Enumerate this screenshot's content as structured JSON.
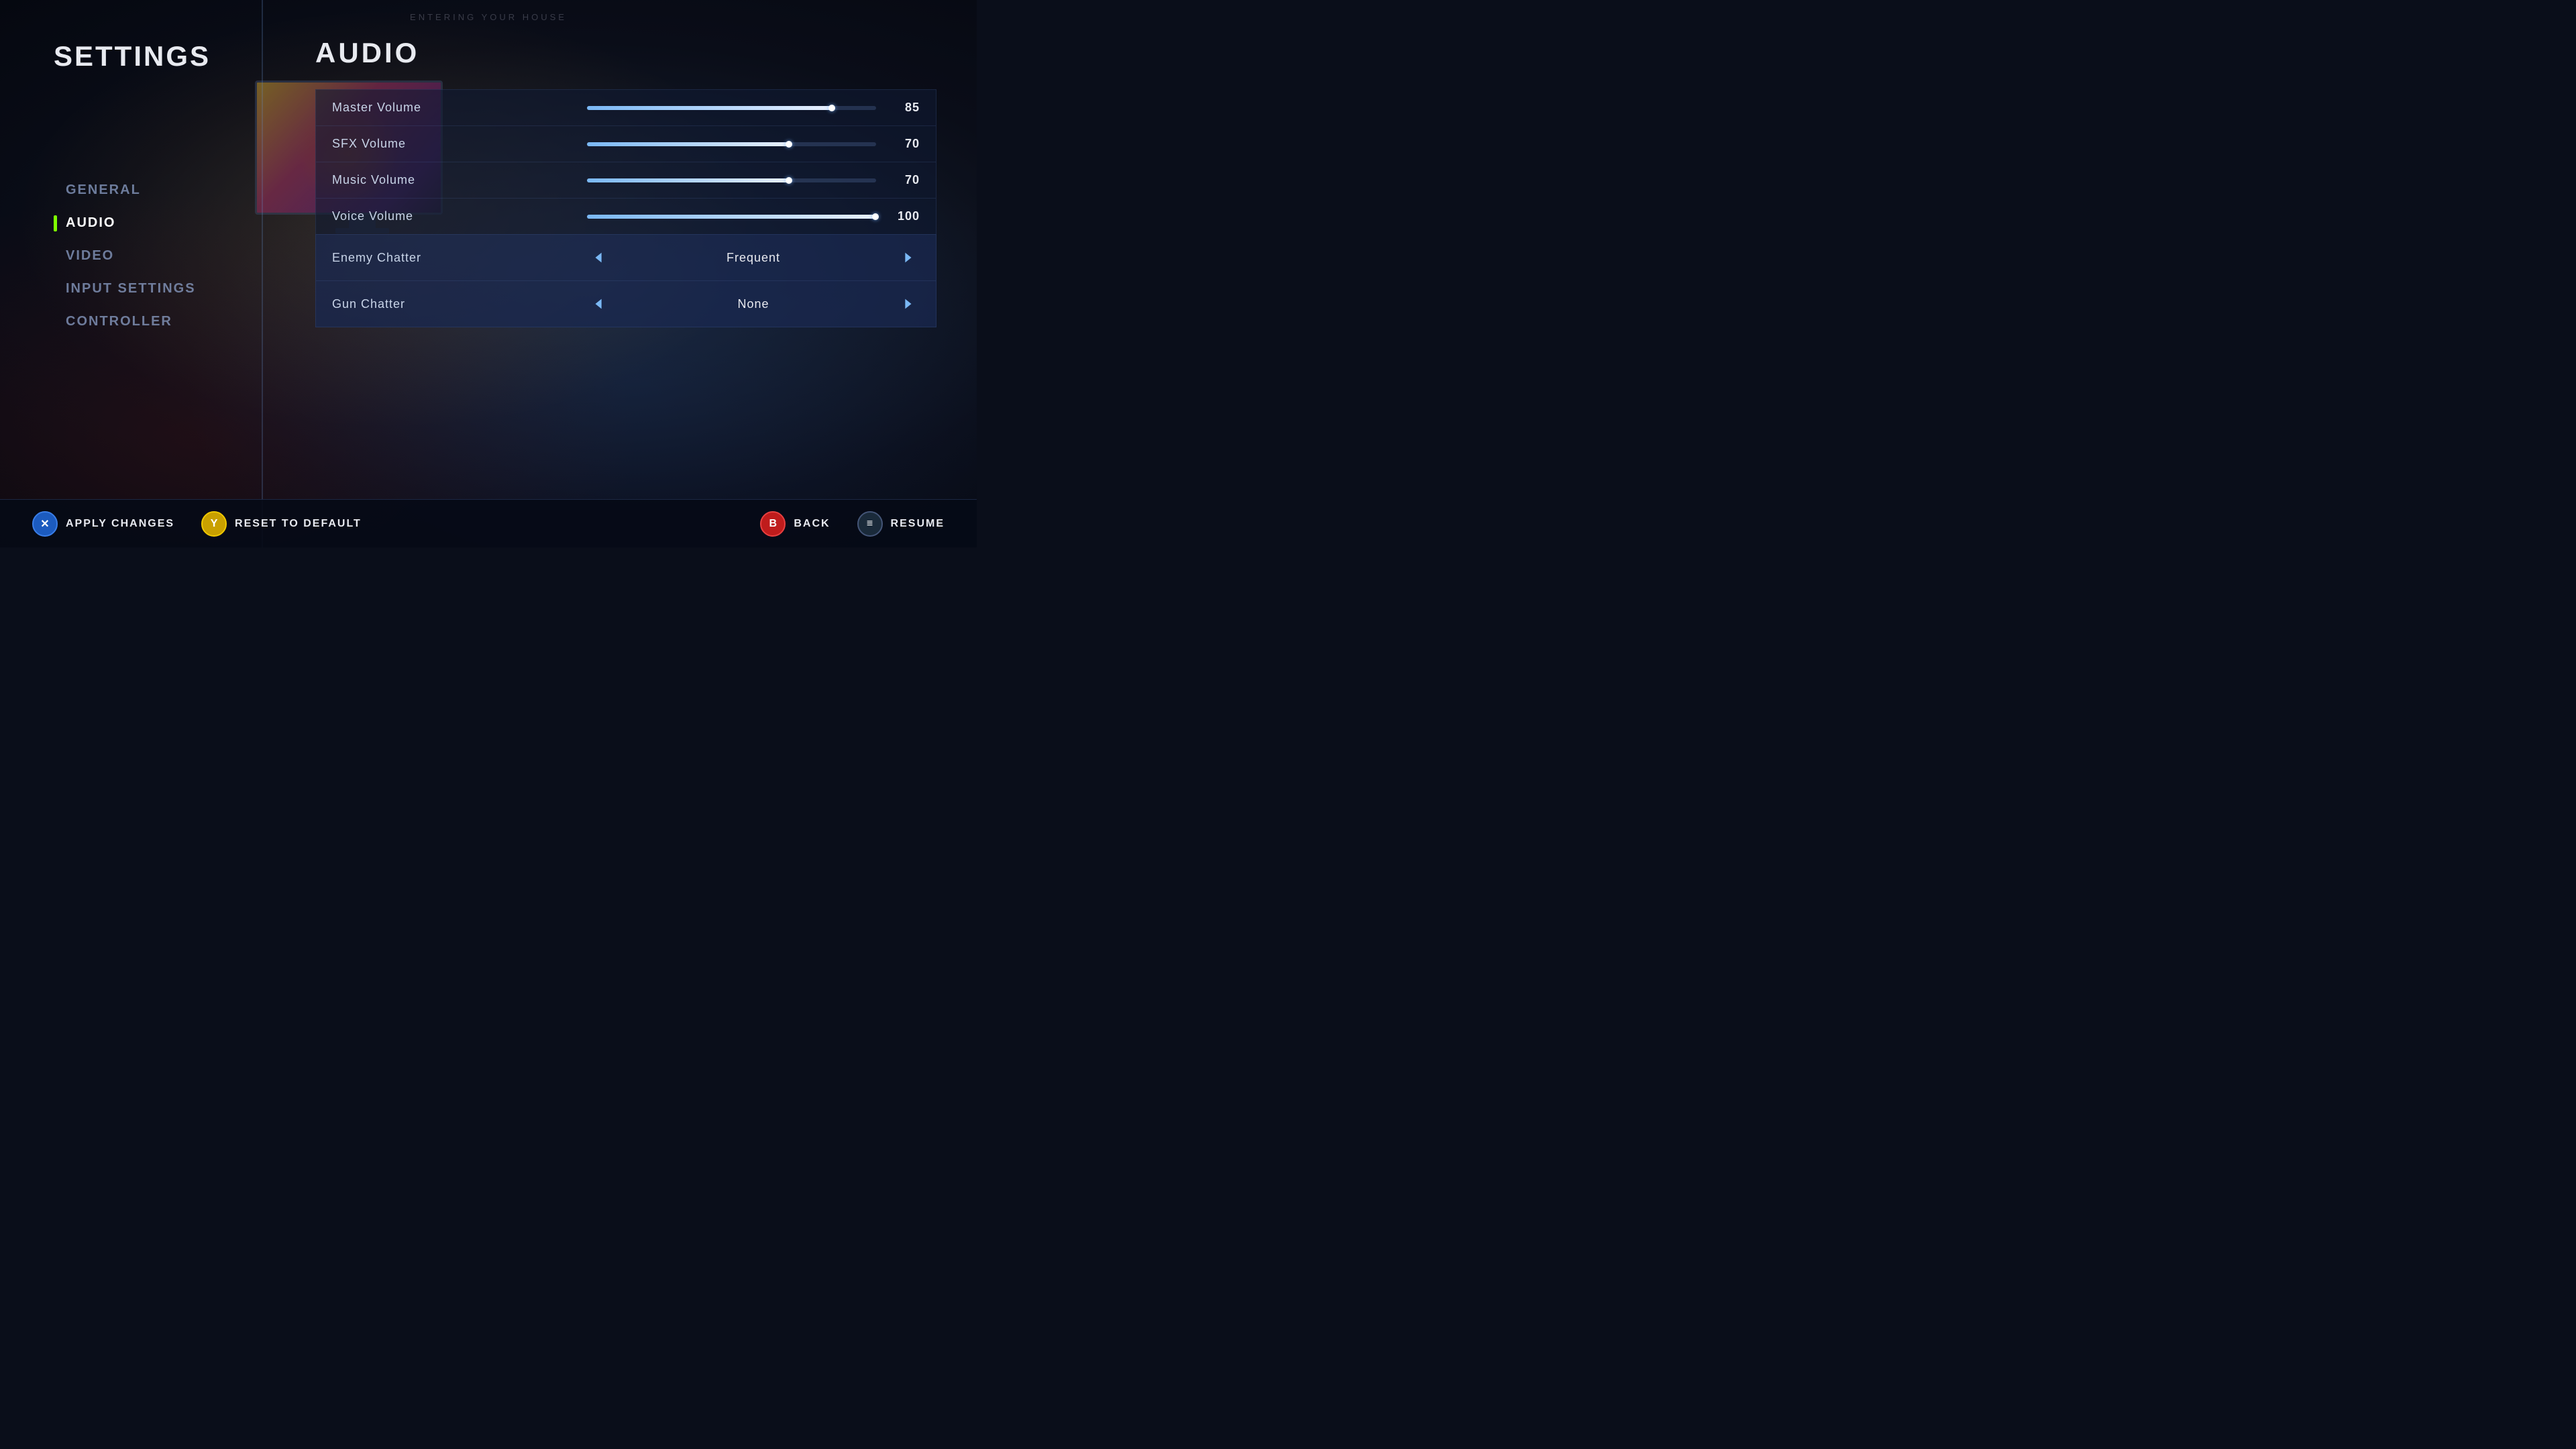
{
  "watermark": {
    "text": "ENTERING YOUR HOUSE"
  },
  "sidebar": {
    "title": "SETTINGS",
    "nav_items": [
      {
        "id": "general",
        "label": "GENERAL",
        "active": false
      },
      {
        "id": "audio",
        "label": "AUDIO",
        "active": true
      },
      {
        "id": "video",
        "label": "VIDEO",
        "active": false
      },
      {
        "id": "input_settings",
        "label": "INPUT SETTINGS",
        "active": false
      },
      {
        "id": "controller",
        "label": "CONTROLLER",
        "active": false
      }
    ]
  },
  "main": {
    "section_title": "AUDIO",
    "settings": [
      {
        "id": "master_volume",
        "label": "Master Volume",
        "type": "slider",
        "value": 85,
        "fill_percent": 85
      },
      {
        "id": "sfx_volume",
        "label": "SFX Volume",
        "type": "slider",
        "value": 70,
        "fill_percent": 70
      },
      {
        "id": "music_volume",
        "label": "Music Volume",
        "type": "slider",
        "value": 70,
        "fill_percent": 70
      },
      {
        "id": "voice_volume",
        "label": "Voice Volume",
        "type": "slider",
        "value": 100,
        "fill_percent": 100
      },
      {
        "id": "enemy_chatter",
        "label": "Enemy Chatter",
        "type": "selector",
        "value": "Frequent"
      },
      {
        "id": "gun_chatter",
        "label": "Gun Chatter",
        "type": "selector",
        "value": "None"
      }
    ]
  },
  "bottom_bar": {
    "left_buttons": [
      {
        "id": "apply_changes",
        "icon": "X",
        "icon_type": "blue",
        "label": "APPLY CHANGES"
      },
      {
        "id": "reset_to_default",
        "icon": "Y",
        "icon_type": "yellow",
        "label": "RESET TO DEFAULT"
      }
    ],
    "right_buttons": [
      {
        "id": "back",
        "icon": "B",
        "icon_type": "red",
        "label": "BACK"
      },
      {
        "id": "resume",
        "icon": "≡",
        "icon_type": "dark",
        "label": "RESUME"
      }
    ]
  }
}
